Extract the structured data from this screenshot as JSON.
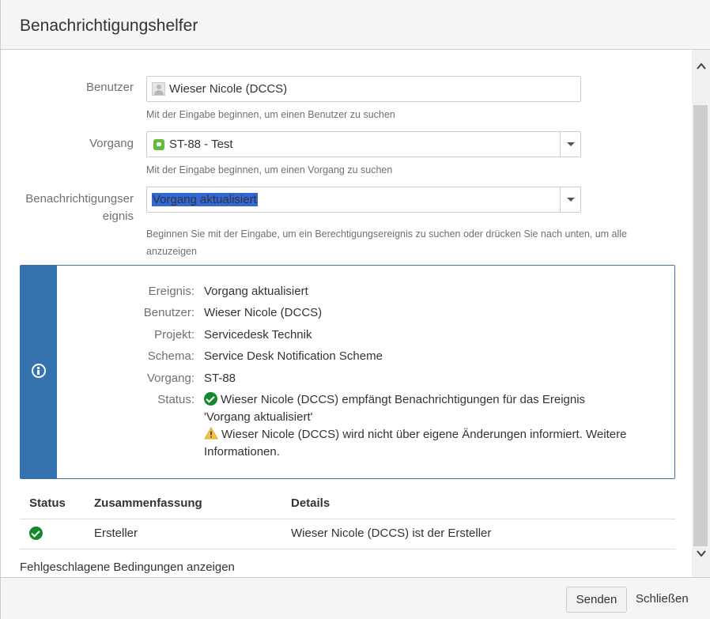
{
  "dialog": {
    "title": "Benachrichtigungshelfer"
  },
  "form": {
    "cut_text": ", ",
    "user": {
      "label": "Benutzer",
      "value": "Wieser Nicole (DCCS)",
      "help": "Mit der Eingabe beginnen, um einen Benutzer zu suchen"
    },
    "issue": {
      "label": "Vorgang",
      "value": "ST-88 - Test",
      "help": "Mit der Eingabe beginnen, um einen Vorgang zu suchen"
    },
    "event": {
      "label_line1": "Benachrichtigungser",
      "label_line2": "eignis",
      "value": "Vorgang aktualisiert",
      "help_line1": "Beginnen Sie mit der Eingabe, um ein Berechtigungsereignis zu suchen oder drücken Sie nach unten, um alle",
      "help_line2": "anzuzeigen"
    }
  },
  "info": {
    "rows": [
      {
        "key": "Ereignis:",
        "value": "Vorgang aktualisiert"
      },
      {
        "key": "Benutzer:",
        "value": "Wieser Nicole (DCCS)"
      },
      {
        "key": "Projekt:",
        "value": "Servicedesk Technik"
      },
      {
        "key": "Schema:",
        "value": "Service Desk Notification Scheme"
      },
      {
        "key": "Vorgang:",
        "value": "ST-88"
      }
    ],
    "status_key": "Status:",
    "status_ok_line1": "Wieser Nicole (DCCS) empfängt Benachrichtigungen für das Ereignis",
    "status_ok_line2": "'Vorgang aktualisiert'",
    "status_warn_line1": "Wieser Nicole (DCCS) wird nicht über eigene Änderungen informiert.",
    "status_warn_link": "Weitere",
    "status_warn_line2": "Informationen."
  },
  "table": {
    "headers": [
      "Status",
      "Zusammenfassung",
      "Details"
    ],
    "rows": [
      {
        "status_icon": "success-icon",
        "summary": "Ersteller",
        "details": "Wieser Nicole (DCCS) ist der Ersteller"
      }
    ]
  },
  "failed_link": "Fehlgeschlagene Bedingungen anzeigen",
  "footer": {
    "send_label": "Senden",
    "close_label": "Schließen"
  },
  "colors": {
    "info_blue": "#3572b0",
    "success_green": "#14892c",
    "selection": "#3367d6",
    "warning_yellow": "#f6c342"
  }
}
